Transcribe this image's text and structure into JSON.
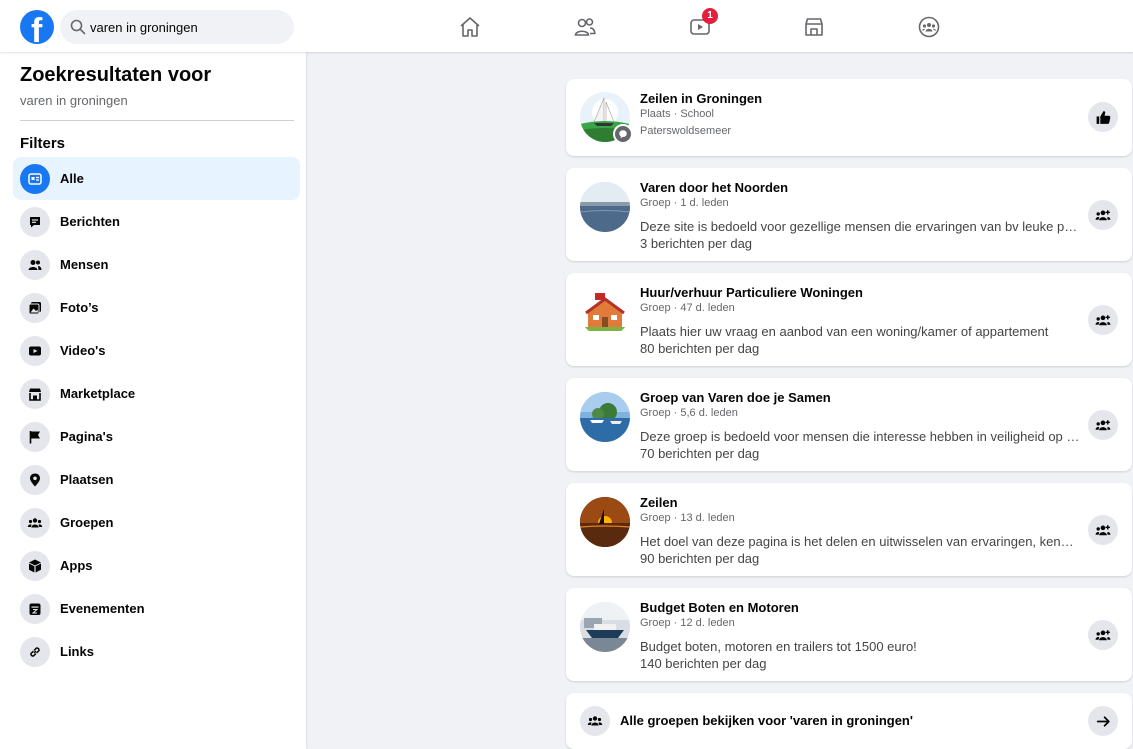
{
  "search": {
    "value": "varen in groningen"
  },
  "nav": {
    "watch_badge": "1"
  },
  "sidebar": {
    "title": "Zoekresultaten voor",
    "subtitle": "varen in groningen",
    "filters_heading": "Filters",
    "items": [
      {
        "label": "Alle",
        "icon": "all-icon",
        "active": true
      },
      {
        "label": "Berichten",
        "icon": "posts-icon"
      },
      {
        "label": "Mensen",
        "icon": "people-icon"
      },
      {
        "label": "Foto’s",
        "icon": "photos-icon"
      },
      {
        "label": "Video's",
        "icon": "video-icon"
      },
      {
        "label": "Marketplace",
        "icon": "marketplace-icon"
      },
      {
        "label": "Pagina's",
        "icon": "flag-icon"
      },
      {
        "label": "Plaatsen",
        "icon": "location-pin-icon"
      },
      {
        "label": "Groepen",
        "icon": "groups-icon"
      },
      {
        "label": "Apps",
        "icon": "box-icon"
      },
      {
        "label": "Evenementen",
        "icon": "calendar-icon"
      },
      {
        "label": "Links",
        "icon": "link-icon"
      }
    ]
  },
  "results": [
    {
      "title": "Zeilen in Groningen",
      "meta": "Plaats · School",
      "meta2": "Paterswoldsemeer",
      "action_icon": "like-icon"
    },
    {
      "title": "Varen door het Noorden",
      "meta": "Groep · 1 d. leden",
      "desc": "Deze site is bedoeld voor gezellige mensen die ervaringen van bv leuke plekken wi...",
      "freq": "3 berichten per dag",
      "action_icon": "join-group-icon"
    },
    {
      "title": "Huur/verhuur Particuliere Woningen",
      "meta": "Groep · 47 d. leden",
      "desc": "Plaats hier uw vraag en aanbod van een woning/kamer of appartement",
      "freq": "80 berichten per dag",
      "action_icon": "join-group-icon"
    },
    {
      "title": "Groep van Varen doe je Samen",
      "meta": "Groep · 5,6 d. leden",
      "desc": "Deze groep is bedoeld voor mensen die interesse hebben in veiligheid op het water...",
      "freq": "70 berichten per dag",
      "action_icon": "join-group-icon"
    },
    {
      "title": "Zeilen",
      "meta": "Groep · 13 d. leden",
      "desc": "Het doel van deze pagina is het delen en uitwisselen van ervaringen, kennis en tips...",
      "freq": "90 berichten per dag",
      "action_icon": "join-group-icon"
    },
    {
      "title": "Budget Boten en Motoren",
      "meta": "Groep · 12 d. leden",
      "desc": "Budget boten, motoren en trailers tot 1500 euro!",
      "freq": "140 berichten per dag",
      "action_icon": "join-group-icon"
    }
  ],
  "footer": {
    "label": "Alle groepen bekijken voor 'varen in groningen'",
    "icon": "groups-icon",
    "arrow_icon": "arrow-right-icon"
  },
  "colors": {
    "brand": "#1877f2",
    "badge": "#e41e3f",
    "active_bg": "#e7f3ff"
  }
}
